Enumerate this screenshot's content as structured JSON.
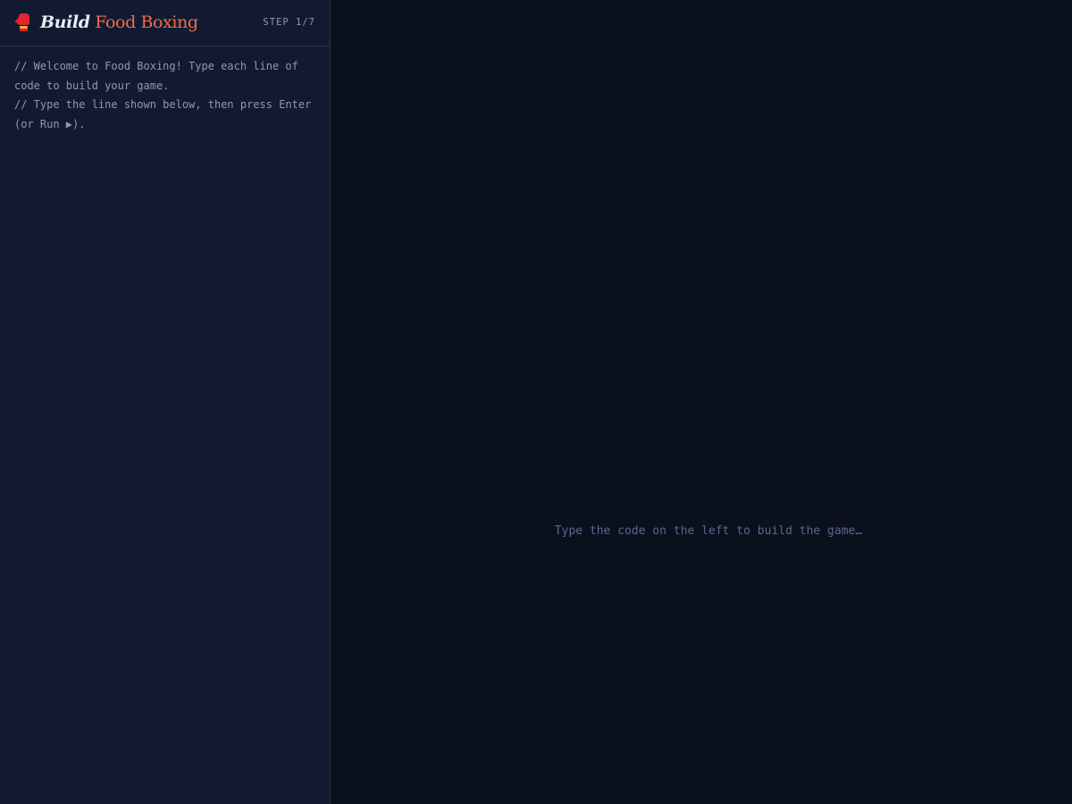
{
  "sidebar": {
    "header": {
      "logo_icon": "boxing-glove-icon",
      "title_build": "Build",
      "title_name": "Food Boxing",
      "step": "STEP 1/7"
    },
    "comments": [
      "// Welcome to Food Boxing! Type each line of code to build your game.",
      "// Type the line shown below, then press Enter (or Run ▶)."
    ]
  },
  "main": {
    "placeholder": "Type the code on the left to build the game…"
  },
  "colors": {
    "accent": "#ef6e4d",
    "sidebar_bg": "#121a32",
    "main_bg": "#0b101d",
    "muted_text": "#8e97b8"
  }
}
